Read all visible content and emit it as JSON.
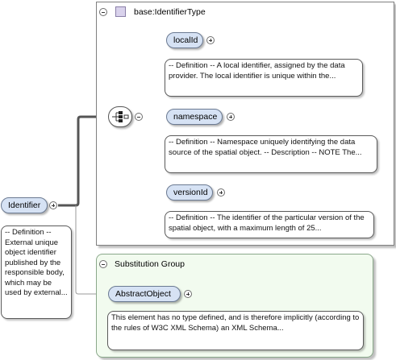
{
  "root": {
    "name": "Identifier",
    "doc": "-- Definition -- External unique object identifier published by the responsible body, which may be used by external..."
  },
  "type": {
    "title": "base:IdentifierType",
    "elements": [
      {
        "name": "localId",
        "doc": "-- Definition -- A local identifier, assigned by the data provider. The local identifier is unique within the..."
      },
      {
        "name": "namespace",
        "doc": "-- Definition -- Namespace uniquely identifying the data source of the spatial object. -- Description -- NOTE The..."
      },
      {
        "name": "versionId",
        "doc": "-- Definition -- The identifier of the particular version of the spatial object, with a maximum length of 25..."
      }
    ]
  },
  "substitution": {
    "title": "Substitution Group",
    "element": {
      "name": "AbstractObject",
      "doc": "This element has no type defined, and is therefore implicitly (according to the rules of W3C XML Schema) an XML Schema..."
    }
  },
  "icons": {
    "type_icon": "type-square-icon",
    "sequence_icon": "sequence-compositor-icon",
    "collapse_icon": "collapse-circle-icon",
    "expand_icon": "expand-circle-icon"
  }
}
